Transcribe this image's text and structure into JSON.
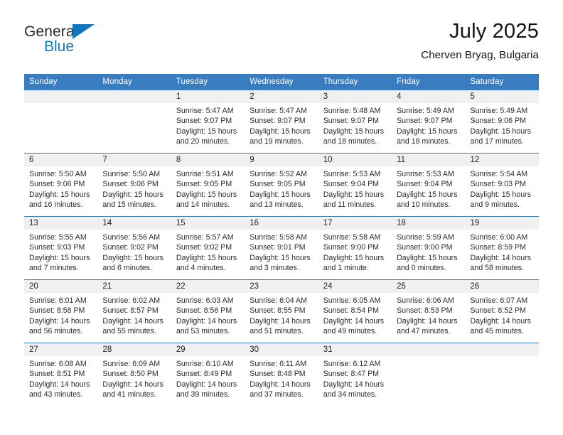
{
  "brand": {
    "name_top": "General",
    "name_bottom": "Blue",
    "triangle_color": "#1277c0"
  },
  "header": {
    "title": "July 2025",
    "subtitle": "Cherven Bryag, Bulgaria"
  },
  "theme": {
    "header_blue": "#3a7cc0",
    "daynum_band": "#f0f0f0",
    "text": "#2b2b2b"
  },
  "weekdays": [
    "Sunday",
    "Monday",
    "Tuesday",
    "Wednesday",
    "Thursday",
    "Friday",
    "Saturday"
  ],
  "labels": {
    "sunrise": "Sunrise:",
    "sunset": "Sunset:",
    "daylight": "Daylight:"
  },
  "weeks": [
    [
      {
        "day": ""
      },
      {
        "day": ""
      },
      {
        "day": "1",
        "sunrise": "Sunrise: 5:47 AM",
        "sunset": "Sunset: 9:07 PM",
        "daylight1": "Daylight: 15 hours",
        "daylight2": "and 20 minutes."
      },
      {
        "day": "2",
        "sunrise": "Sunrise: 5:47 AM",
        "sunset": "Sunset: 9:07 PM",
        "daylight1": "Daylight: 15 hours",
        "daylight2": "and 19 minutes."
      },
      {
        "day": "3",
        "sunrise": "Sunrise: 5:48 AM",
        "sunset": "Sunset: 9:07 PM",
        "daylight1": "Daylight: 15 hours",
        "daylight2": "and 18 minutes."
      },
      {
        "day": "4",
        "sunrise": "Sunrise: 5:49 AM",
        "sunset": "Sunset: 9:07 PM",
        "daylight1": "Daylight: 15 hours",
        "daylight2": "and 18 minutes."
      },
      {
        "day": "5",
        "sunrise": "Sunrise: 5:49 AM",
        "sunset": "Sunset: 9:06 PM",
        "daylight1": "Daylight: 15 hours",
        "daylight2": "and 17 minutes."
      }
    ],
    [
      {
        "day": "6",
        "sunrise": "Sunrise: 5:50 AM",
        "sunset": "Sunset: 9:06 PM",
        "daylight1": "Daylight: 15 hours",
        "daylight2": "and 16 minutes."
      },
      {
        "day": "7",
        "sunrise": "Sunrise: 5:50 AM",
        "sunset": "Sunset: 9:06 PM",
        "daylight1": "Daylight: 15 hours",
        "daylight2": "and 15 minutes."
      },
      {
        "day": "8",
        "sunrise": "Sunrise: 5:51 AM",
        "sunset": "Sunset: 9:05 PM",
        "daylight1": "Daylight: 15 hours",
        "daylight2": "and 14 minutes."
      },
      {
        "day": "9",
        "sunrise": "Sunrise: 5:52 AM",
        "sunset": "Sunset: 9:05 PM",
        "daylight1": "Daylight: 15 hours",
        "daylight2": "and 13 minutes."
      },
      {
        "day": "10",
        "sunrise": "Sunrise: 5:53 AM",
        "sunset": "Sunset: 9:04 PM",
        "daylight1": "Daylight: 15 hours",
        "daylight2": "and 11 minutes."
      },
      {
        "day": "11",
        "sunrise": "Sunrise: 5:53 AM",
        "sunset": "Sunset: 9:04 PM",
        "daylight1": "Daylight: 15 hours",
        "daylight2": "and 10 minutes."
      },
      {
        "day": "12",
        "sunrise": "Sunrise: 5:54 AM",
        "sunset": "Sunset: 9:03 PM",
        "daylight1": "Daylight: 15 hours",
        "daylight2": "and 9 minutes."
      }
    ],
    [
      {
        "day": "13",
        "sunrise": "Sunrise: 5:55 AM",
        "sunset": "Sunset: 9:03 PM",
        "daylight1": "Daylight: 15 hours",
        "daylight2": "and 7 minutes."
      },
      {
        "day": "14",
        "sunrise": "Sunrise: 5:56 AM",
        "sunset": "Sunset: 9:02 PM",
        "daylight1": "Daylight: 15 hours",
        "daylight2": "and 6 minutes."
      },
      {
        "day": "15",
        "sunrise": "Sunrise: 5:57 AM",
        "sunset": "Sunset: 9:02 PM",
        "daylight1": "Daylight: 15 hours",
        "daylight2": "and 4 minutes."
      },
      {
        "day": "16",
        "sunrise": "Sunrise: 5:58 AM",
        "sunset": "Sunset: 9:01 PM",
        "daylight1": "Daylight: 15 hours",
        "daylight2": "and 3 minutes."
      },
      {
        "day": "17",
        "sunrise": "Sunrise: 5:58 AM",
        "sunset": "Sunset: 9:00 PM",
        "daylight1": "Daylight: 15 hours",
        "daylight2": "and 1 minute."
      },
      {
        "day": "18",
        "sunrise": "Sunrise: 5:59 AM",
        "sunset": "Sunset: 9:00 PM",
        "daylight1": "Daylight: 15 hours",
        "daylight2": "and 0 minutes."
      },
      {
        "day": "19",
        "sunrise": "Sunrise: 6:00 AM",
        "sunset": "Sunset: 8:59 PM",
        "daylight1": "Daylight: 14 hours",
        "daylight2": "and 58 minutes."
      }
    ],
    [
      {
        "day": "20",
        "sunrise": "Sunrise: 6:01 AM",
        "sunset": "Sunset: 8:58 PM",
        "daylight1": "Daylight: 14 hours",
        "daylight2": "and 56 minutes."
      },
      {
        "day": "21",
        "sunrise": "Sunrise: 6:02 AM",
        "sunset": "Sunset: 8:57 PM",
        "daylight1": "Daylight: 14 hours",
        "daylight2": "and 55 minutes."
      },
      {
        "day": "22",
        "sunrise": "Sunrise: 6:03 AM",
        "sunset": "Sunset: 8:56 PM",
        "daylight1": "Daylight: 14 hours",
        "daylight2": "and 53 minutes."
      },
      {
        "day": "23",
        "sunrise": "Sunrise: 6:04 AM",
        "sunset": "Sunset: 8:55 PM",
        "daylight1": "Daylight: 14 hours",
        "daylight2": "and 51 minutes."
      },
      {
        "day": "24",
        "sunrise": "Sunrise: 6:05 AM",
        "sunset": "Sunset: 8:54 PM",
        "daylight1": "Daylight: 14 hours",
        "daylight2": "and 49 minutes."
      },
      {
        "day": "25",
        "sunrise": "Sunrise: 6:06 AM",
        "sunset": "Sunset: 8:53 PM",
        "daylight1": "Daylight: 14 hours",
        "daylight2": "and 47 minutes."
      },
      {
        "day": "26",
        "sunrise": "Sunrise: 6:07 AM",
        "sunset": "Sunset: 8:52 PM",
        "daylight1": "Daylight: 14 hours",
        "daylight2": "and 45 minutes."
      }
    ],
    [
      {
        "day": "27",
        "sunrise": "Sunrise: 6:08 AM",
        "sunset": "Sunset: 8:51 PM",
        "daylight1": "Daylight: 14 hours",
        "daylight2": "and 43 minutes."
      },
      {
        "day": "28",
        "sunrise": "Sunrise: 6:09 AM",
        "sunset": "Sunset: 8:50 PM",
        "daylight1": "Daylight: 14 hours",
        "daylight2": "and 41 minutes."
      },
      {
        "day": "29",
        "sunrise": "Sunrise: 6:10 AM",
        "sunset": "Sunset: 8:49 PM",
        "daylight1": "Daylight: 14 hours",
        "daylight2": "and 39 minutes."
      },
      {
        "day": "30",
        "sunrise": "Sunrise: 6:11 AM",
        "sunset": "Sunset: 8:48 PM",
        "daylight1": "Daylight: 14 hours",
        "daylight2": "and 37 minutes."
      },
      {
        "day": "31",
        "sunrise": "Sunrise: 6:12 AM",
        "sunset": "Sunset: 8:47 PM",
        "daylight1": "Daylight: 14 hours",
        "daylight2": "and 34 minutes."
      },
      {
        "day": ""
      },
      {
        "day": ""
      }
    ]
  ]
}
